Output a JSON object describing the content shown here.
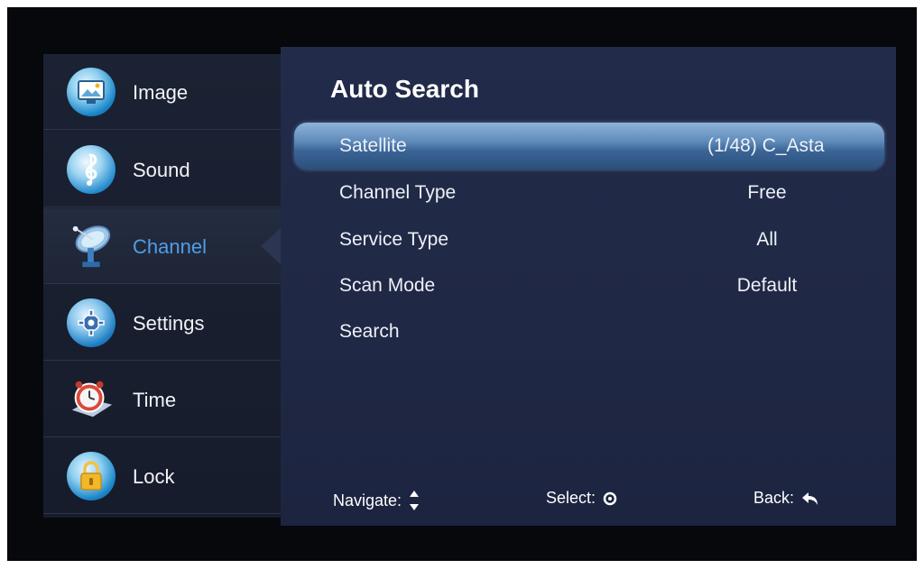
{
  "sidebar": {
    "items": [
      {
        "label": "Image",
        "icon": "image-icon",
        "active": false
      },
      {
        "label": "Sound",
        "icon": "music-note-icon",
        "active": false
      },
      {
        "label": "Channel",
        "icon": "satellite-dish-icon",
        "active": true
      },
      {
        "label": "Settings",
        "icon": "gear-icon",
        "active": false
      },
      {
        "label": "Time",
        "icon": "alarm-clock-icon",
        "active": false
      },
      {
        "label": "Lock",
        "icon": "padlock-icon",
        "active": false
      }
    ]
  },
  "main": {
    "title": "Auto Search",
    "rows": [
      {
        "label": "Satellite",
        "value": "(1/48)  C_Asta",
        "selected": true
      },
      {
        "label": "Channel Type",
        "value": "Free",
        "selected": false
      },
      {
        "label": "Service Type",
        "value": "All",
        "selected": false
      },
      {
        "label": "Scan Mode",
        "value": "Default",
        "selected": false
      },
      {
        "label": "Search",
        "value": "",
        "selected": false
      }
    ]
  },
  "footer": {
    "navigate_label": "Navigate:",
    "select_label": "Select:",
    "back_label": "Back:"
  },
  "colors": {
    "active_text": "#4f9ee8",
    "panel_bg": "#222b4a",
    "sidebar_bg": "#1b2233",
    "highlight": "#5f8bbb"
  }
}
